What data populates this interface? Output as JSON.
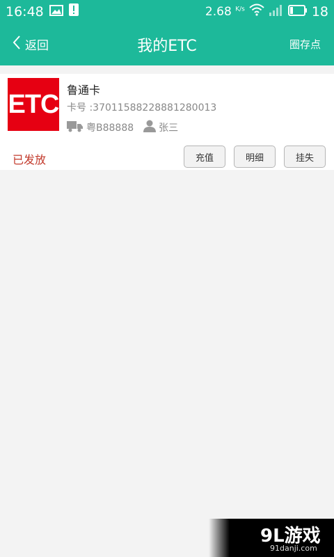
{
  "status_bar": {
    "time": "16:48",
    "speed": "2.68",
    "speed_unit": "K/s",
    "battery": "18"
  },
  "app_bar": {
    "back_label": "返回",
    "title": "我的ETC",
    "right_action": "圈存点"
  },
  "card": {
    "logo_text": "ETC",
    "name": "鲁通卡",
    "card_number": "卡号 :37011588228881280013",
    "plate": "粤B88888",
    "owner": "张三",
    "status": "已发放",
    "buttons": {
      "recharge": "充值",
      "details": "明细",
      "report_loss": "挂失"
    }
  },
  "watermark": {
    "main": "9L游戏",
    "sub": "91danji.com"
  },
  "colors": {
    "primary": "#1db99a",
    "etc_red": "#e60012",
    "status_red": "#c2392b"
  }
}
